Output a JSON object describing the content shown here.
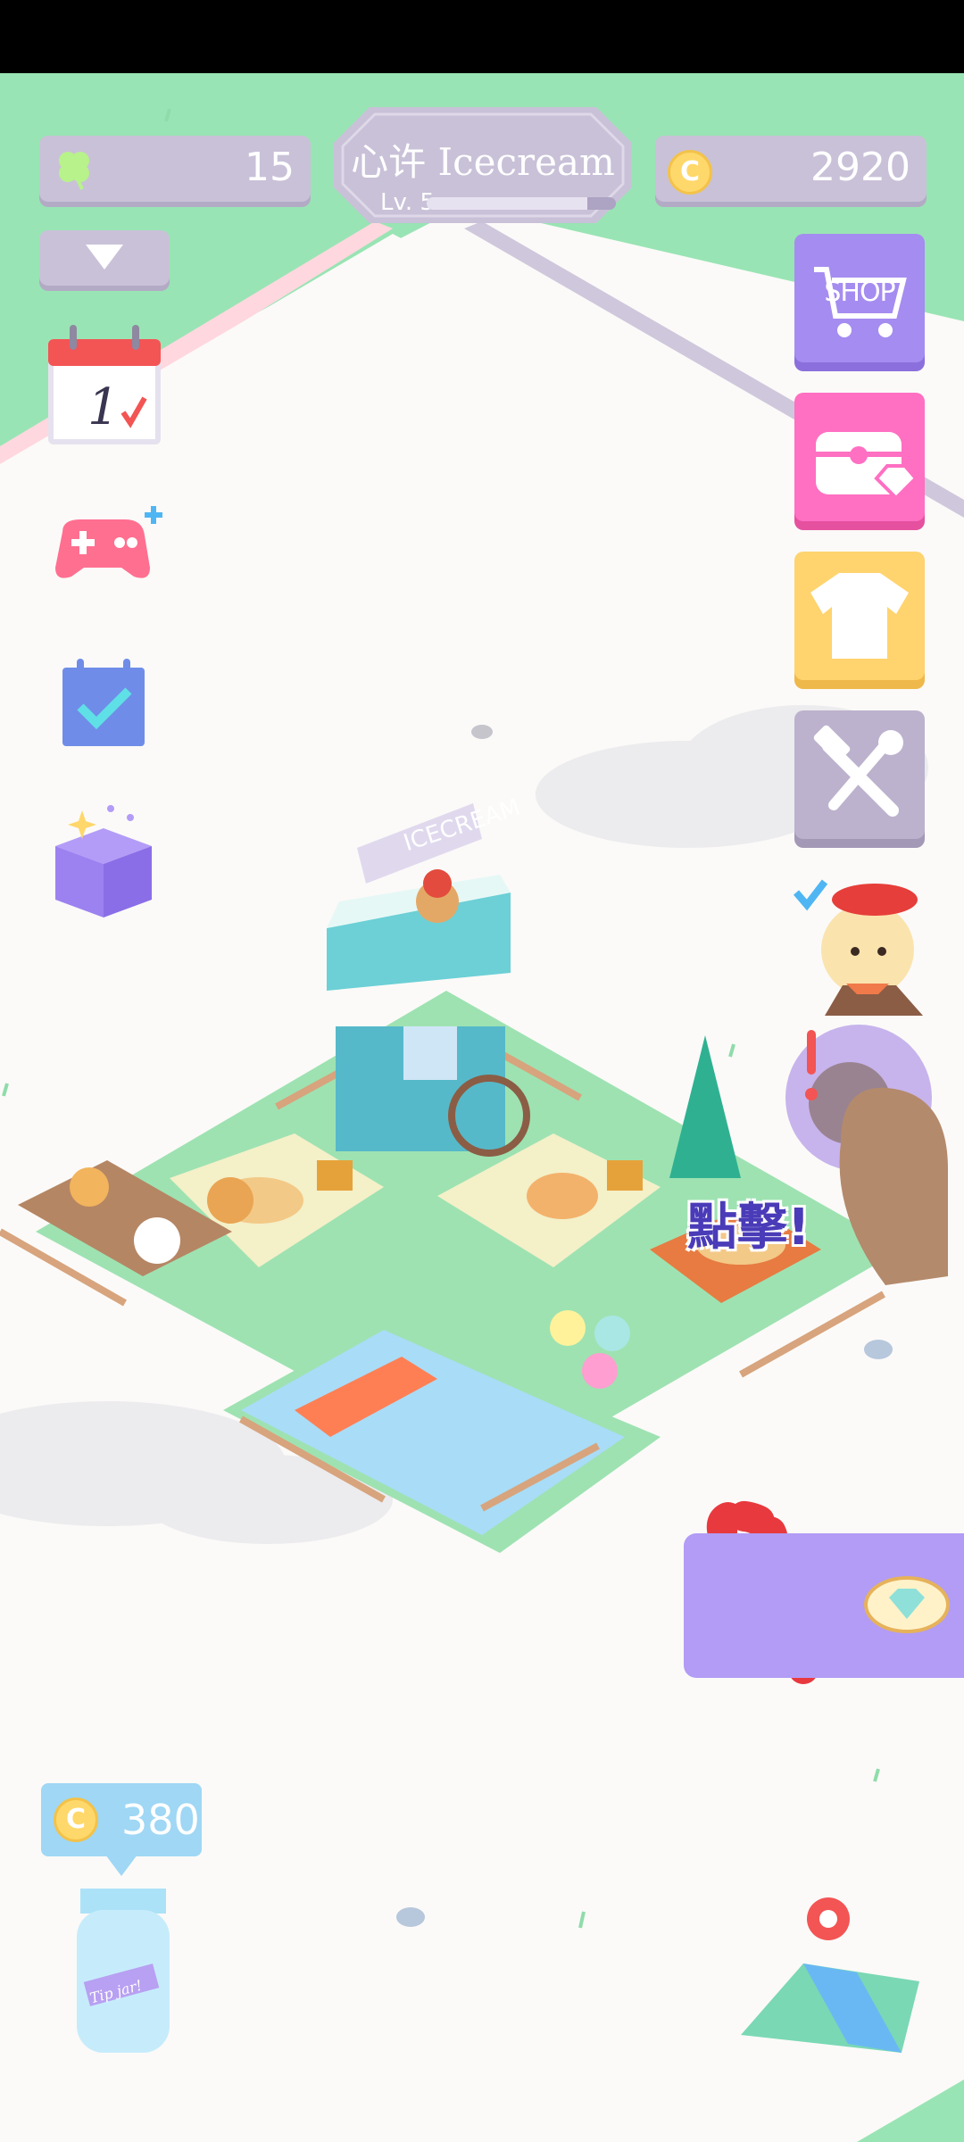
{
  "hud": {
    "clovers": "15",
    "coins": "2920",
    "coin_symbol": "C",
    "player_name": "心许 Icecream",
    "level_text": "Lv. 5",
    "level_progress": 0.85,
    "dropdown_icon": "triangle-down-icon"
  },
  "left_menu": [
    {
      "name": "calendar-check-in",
      "icon": "calendar-icon",
      "day": "1"
    },
    {
      "name": "minigames",
      "icon": "gamepad-plus-icon"
    },
    {
      "name": "daily-tasks",
      "icon": "task-checkbox-icon"
    },
    {
      "name": "gift-box",
      "icon": "sparkle-box-icon"
    }
  ],
  "right_menu": {
    "shop_label": "SHOP",
    "items": [
      "shop",
      "treasure-chest",
      "wardrobe",
      "tools"
    ]
  },
  "scene": {
    "stand_sign": "ICECREAM",
    "tap_prompt": "點擊!"
  },
  "tip_jar": {
    "amount": "380",
    "jar_label": "Tip jar!"
  },
  "colors": {
    "grass": "#99e4b4",
    "hud_purple": "#c9c1d8",
    "shop_purple": "#a58cf0",
    "chest_pink": "#ff6fc2",
    "shirt_yellow": "#ffd36e",
    "tools_grey": "#bcb2cd"
  }
}
